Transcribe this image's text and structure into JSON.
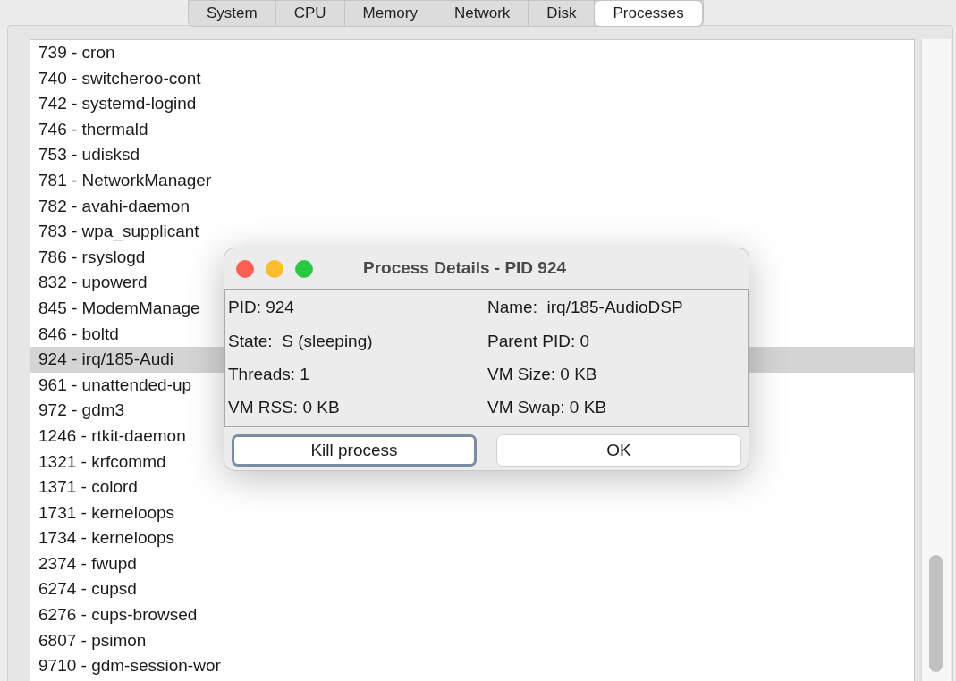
{
  "tabs": [
    {
      "label": "System",
      "selected": false
    },
    {
      "label": "CPU",
      "selected": false
    },
    {
      "label": "Memory",
      "selected": false
    },
    {
      "label": "Network",
      "selected": false
    },
    {
      "label": "Disk",
      "selected": false
    },
    {
      "label": "Processes",
      "selected": true
    }
  ],
  "processes": [
    {
      "label": "739 - cron",
      "selected": false
    },
    {
      "label": "740 - switcheroo-cont",
      "selected": false
    },
    {
      "label": "742 - systemd-logind",
      "selected": false
    },
    {
      "label": "746 - thermald",
      "selected": false
    },
    {
      "label": "753 - udisksd",
      "selected": false
    },
    {
      "label": "781 - NetworkManager",
      "selected": false
    },
    {
      "label": "782 - avahi-daemon",
      "selected": false
    },
    {
      "label": "783 - wpa_supplicant",
      "selected": false
    },
    {
      "label": "786 - rsyslogd",
      "selected": false
    },
    {
      "label": "832 - upowerd",
      "selected": false
    },
    {
      "label": "845 - ModemManage",
      "selected": false
    },
    {
      "label": "846 - boltd",
      "selected": false
    },
    {
      "label": "924 - irq/185-Audi",
      "selected": true
    },
    {
      "label": "961 - unattended-up",
      "selected": false
    },
    {
      "label": "972 - gdm3",
      "selected": false
    },
    {
      "label": "1246 - rtkit-daemon",
      "selected": false
    },
    {
      "label": "1321 - krfcommd",
      "selected": false
    },
    {
      "label": "1371 - colord",
      "selected": false
    },
    {
      "label": "1731 - kerneloops",
      "selected": false
    },
    {
      "label": "1734 - kerneloops",
      "selected": false
    },
    {
      "label": "2374 - fwupd",
      "selected": false
    },
    {
      "label": "6274 - cupsd",
      "selected": false
    },
    {
      "label": "6276 - cups-browsed",
      "selected": false
    },
    {
      "label": "6807 - psimon",
      "selected": false
    },
    {
      "label": "9710 - gdm-session-wor",
      "selected": false
    }
  ],
  "dialog": {
    "title": "Process Details - PID 924",
    "fields": [
      "PID: 924",
      "Name:  irq/185-AudioDSP",
      "State:  S (sleeping)",
      "Parent PID: 0",
      "Threads: 1",
      "VM Size: 0 KB",
      "VM RSS: 0 KB",
      "VM Swap: 0 KB"
    ],
    "buttons": [
      {
        "label": "Kill process",
        "focused": true
      },
      {
        "label": "OK",
        "focused": false
      }
    ]
  }
}
